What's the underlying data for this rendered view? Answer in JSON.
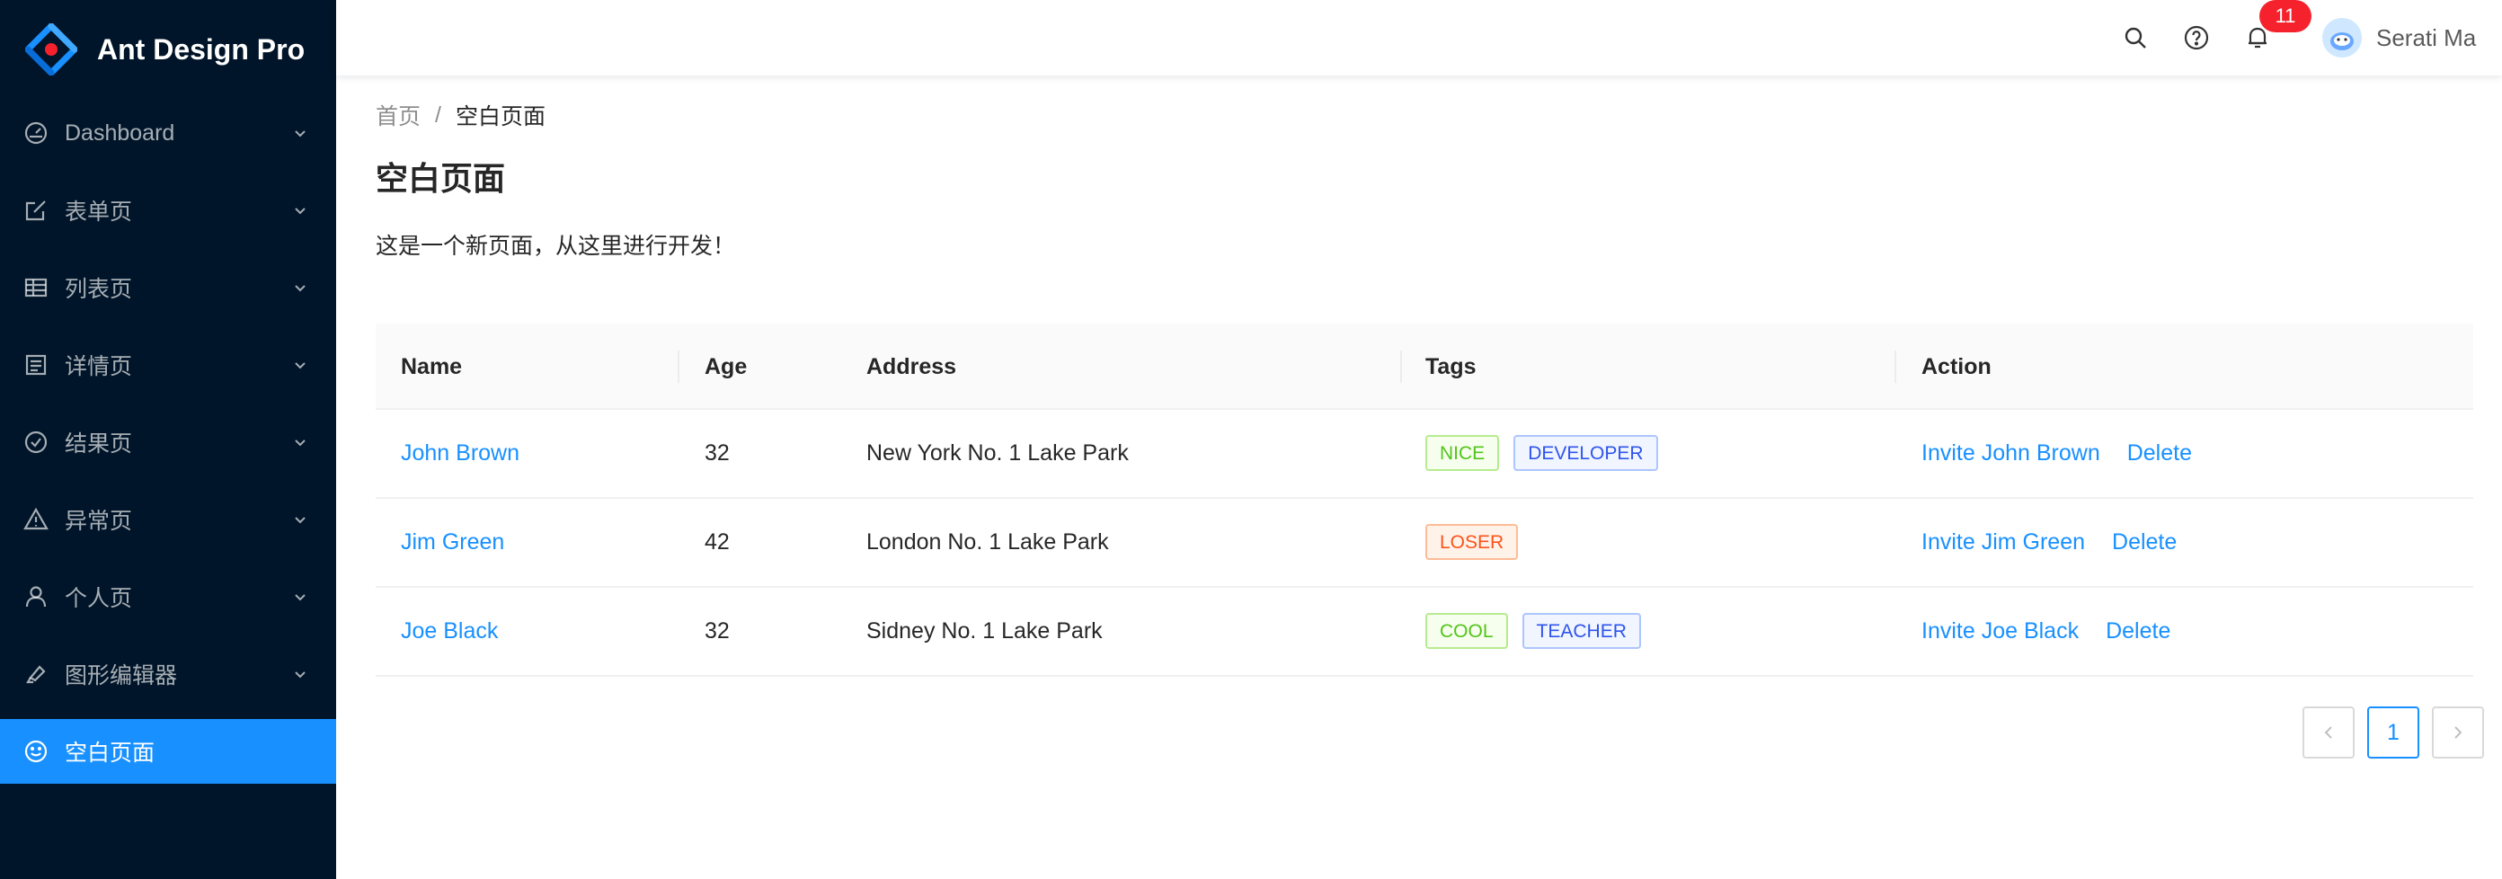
{
  "app": {
    "title": "Ant Design Pro"
  },
  "colors": {
    "sidebar_bg": "#001529",
    "primary": "#1890ff",
    "badge": "#f5222d"
  },
  "sidebar": {
    "items": [
      {
        "label": "Dashboard",
        "icon": "dashboard-icon",
        "expandable": true
      },
      {
        "label": "表单页",
        "icon": "form-icon",
        "expandable": true
      },
      {
        "label": "列表页",
        "icon": "table-icon",
        "expandable": true
      },
      {
        "label": "详情页",
        "icon": "profile-icon",
        "expandable": true
      },
      {
        "label": "结果页",
        "icon": "check-circle-icon",
        "expandable": true
      },
      {
        "label": "异常页",
        "icon": "warning-icon",
        "expandable": true
      },
      {
        "label": "个人页",
        "icon": "user-icon",
        "expandable": true
      },
      {
        "label": "图形编辑器",
        "icon": "highlight-icon",
        "expandable": true
      },
      {
        "label": "空白页面",
        "icon": "smile-icon",
        "expandable": false,
        "active": true
      }
    ]
  },
  "header": {
    "icons": [
      "search-icon",
      "question-circle-icon",
      "bell-icon"
    ],
    "notification_count": "11",
    "user_name": "Serati Ma"
  },
  "breadcrumb": {
    "home": "首页",
    "separator": "/",
    "current": "空白页面"
  },
  "page": {
    "title": "空白页面",
    "description": "这是一个新页面，从这里进行开发！"
  },
  "table": {
    "columns": [
      "Name",
      "Age",
      "Address",
      "Tags",
      "Action"
    ],
    "rows": [
      {
        "name": "John Brown",
        "age": "32",
        "address": "New York No. 1 Lake Park",
        "tags": [
          {
            "text": "NICE",
            "color": "green"
          },
          {
            "text": "DEVELOPER",
            "color": "geekblue"
          }
        ],
        "invite": "Invite John Brown",
        "delete": "Delete"
      },
      {
        "name": "Jim Green",
        "age": "42",
        "address": "London No. 1 Lake Park",
        "tags": [
          {
            "text": "LOSER",
            "color": "volcano"
          }
        ],
        "invite": "Invite Jim Green",
        "delete": "Delete"
      },
      {
        "name": "Joe Black",
        "age": "32",
        "address": "Sidney No. 1 Lake Park",
        "tags": [
          {
            "text": "COOL",
            "color": "green"
          },
          {
            "text": "TEACHER",
            "color": "geekblue"
          }
        ],
        "invite": "Invite Joe Black",
        "delete": "Delete"
      }
    ]
  },
  "pagination": {
    "current": "1"
  }
}
